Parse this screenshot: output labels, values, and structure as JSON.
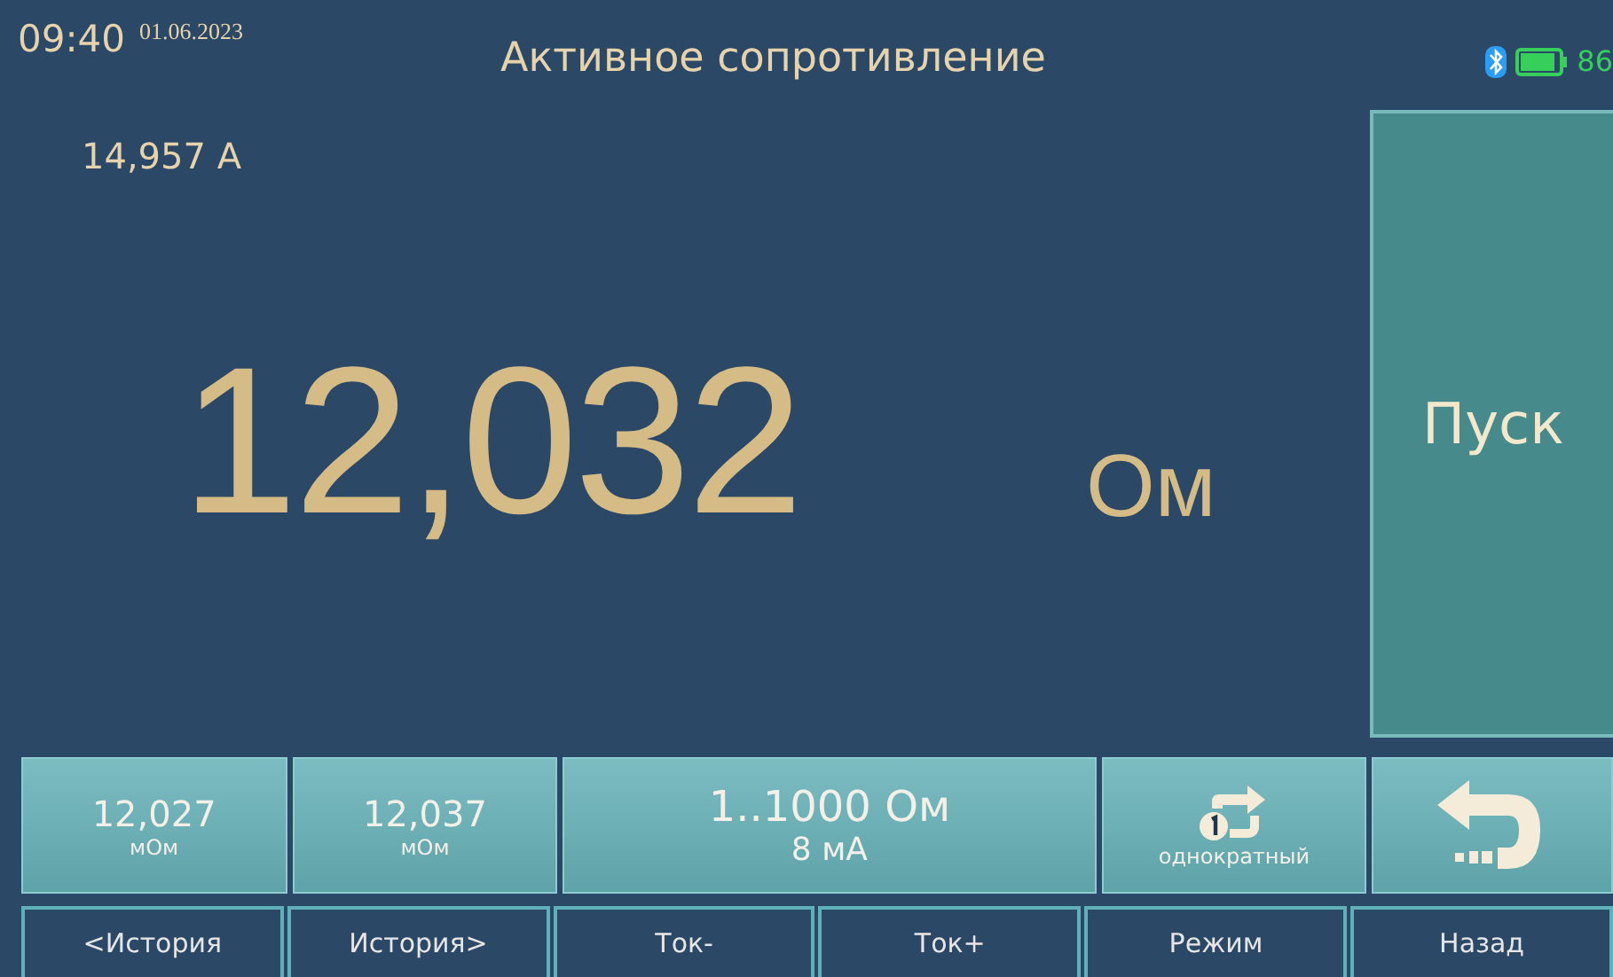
{
  "status_bar": {
    "time": "09:40",
    "date": "01.06.2023",
    "title": "Активное сопротивление",
    "battery_text": "86"
  },
  "current": "14,957 A",
  "reading": {
    "value": "12,032",
    "unit": "Ом"
  },
  "start_button": "Пуск",
  "tiles": [
    {
      "kind": "history",
      "value": "12,027",
      "unit": "мОм"
    },
    {
      "kind": "history",
      "value": "12,037",
      "unit": "мОм"
    },
    {
      "kind": "range",
      "value": "1..1000 Ом",
      "unit": "8 мА"
    },
    {
      "kind": "mode",
      "unit": "однократный"
    },
    {
      "kind": "back"
    }
  ],
  "softkeys": [
    "<История",
    "История>",
    "Ток-",
    "Ток+",
    "Режим",
    "Назад"
  ]
}
